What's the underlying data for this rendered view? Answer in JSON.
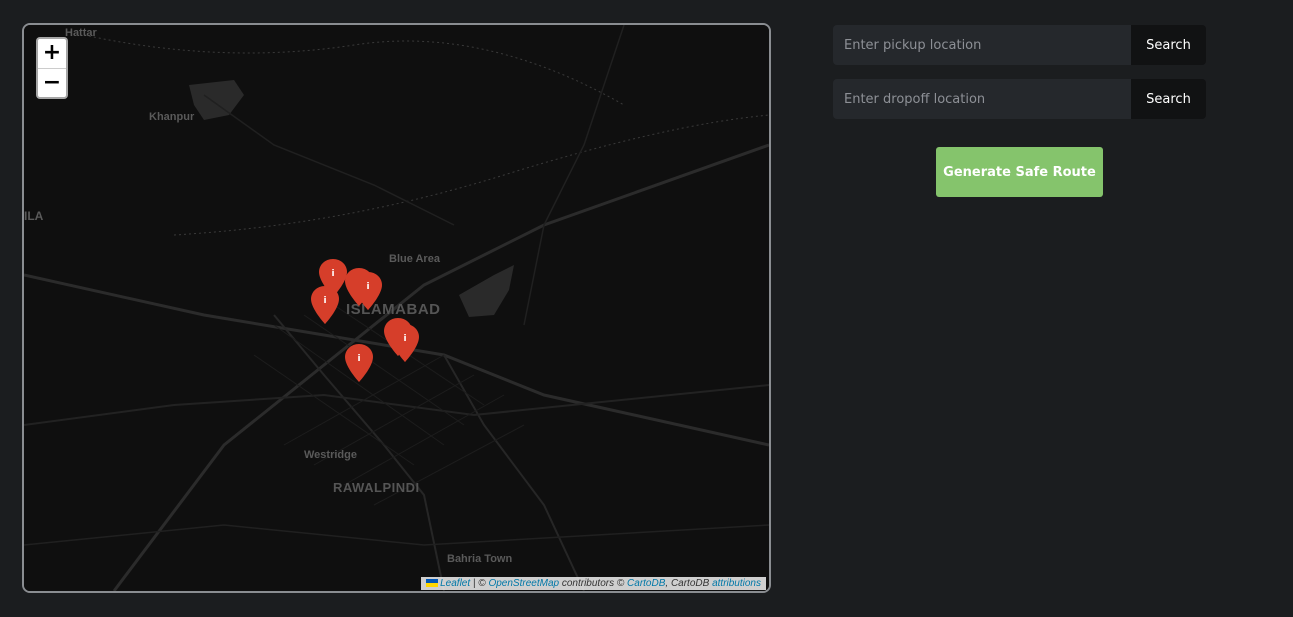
{
  "map": {
    "zoom_in_label": "+",
    "zoom_out_label": "−",
    "places": {
      "hattar": "Hattar",
      "khanpur": "Khanpur",
      "ila": "ILA",
      "blue_area": "Blue Area",
      "islamabad": "ISLAMABAD",
      "westridge": "Westridge",
      "rawalpindi": "RAWALPINDI",
      "bahria_town": "Bahria Town"
    },
    "marker_icon": "info-icon",
    "marker_color": "#d63e2a",
    "attribution": {
      "leaflet": "Leaflet",
      "sep": " | © ",
      "osm": "OpenStreetMap",
      "contributors": " contributors © ",
      "cartodb": "CartoDB",
      "cartodb_plain": ", CartoDB ",
      "attributions": "attributions"
    }
  },
  "pickup": {
    "placeholder": "Enter pickup location",
    "button_label": "Search"
  },
  "dropoff": {
    "placeholder": "Enter dropoff location",
    "button_label": "Search"
  },
  "generate_label": "Generate Safe Route",
  "colors": {
    "background": "#1b1d1f",
    "accent": "#85c46c",
    "input_bg": "#25282c"
  }
}
